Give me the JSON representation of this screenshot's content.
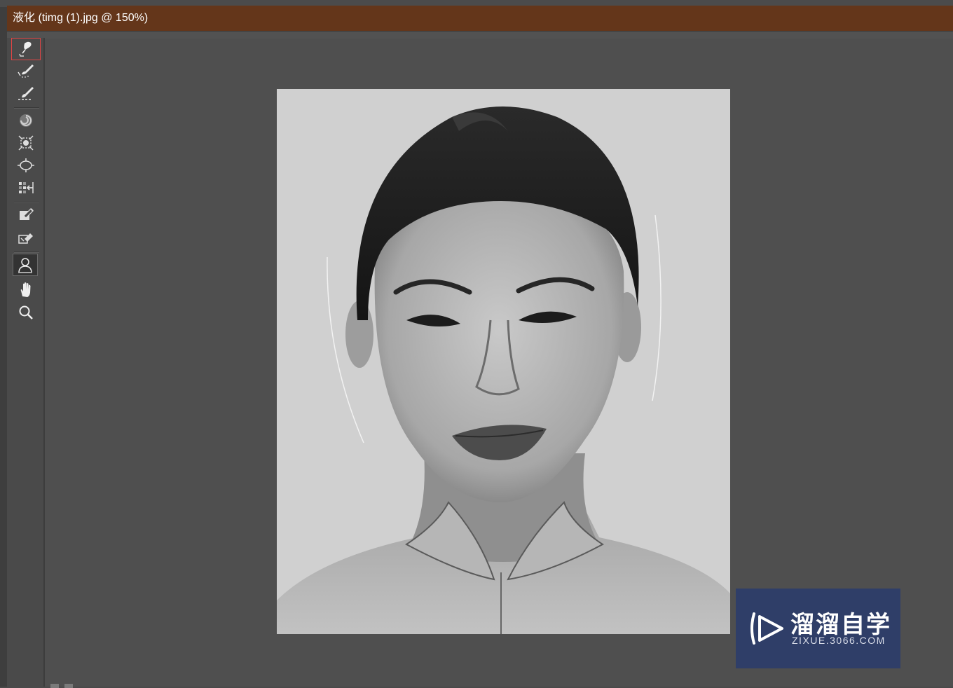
{
  "window": {
    "title": "液化 (timg (1).jpg @ 150%)",
    "title_bar_color": "#64361a",
    "zoom_level": "150%"
  },
  "toolbar": {
    "tools": [
      {
        "name": "forward-warp-tool",
        "icon": "warp-brush-icon",
        "selected": true
      },
      {
        "name": "reconstruct-tool",
        "icon": "reconstruct-brush-icon"
      },
      {
        "name": "smooth-tool",
        "icon": "smooth-brush-icon"
      },
      {
        "name": "twirl-clockwise-tool",
        "icon": "twirl-icon"
      },
      {
        "name": "pucker-tool",
        "icon": "pucker-icon"
      },
      {
        "name": "bloat-tool",
        "icon": "bloat-icon"
      },
      {
        "name": "push-left-tool",
        "icon": "push-left-icon"
      },
      {
        "name": "freeze-mask-tool",
        "icon": "freeze-mask-icon"
      },
      {
        "name": "thaw-mask-tool",
        "icon": "thaw-mask-icon"
      },
      {
        "name": "face-tool",
        "icon": "face-icon",
        "active": true
      },
      {
        "name": "hand-tool",
        "icon": "hand-icon"
      },
      {
        "name": "zoom-tool",
        "icon": "zoom-icon"
      }
    ],
    "selection_color": "#e04545"
  },
  "annotation": {
    "arrow_color": "#e53935"
  },
  "watermark": {
    "title": "溜溜自学",
    "subtitle": "ZIXUE.3066.COM",
    "background": "#2f3e68"
  }
}
